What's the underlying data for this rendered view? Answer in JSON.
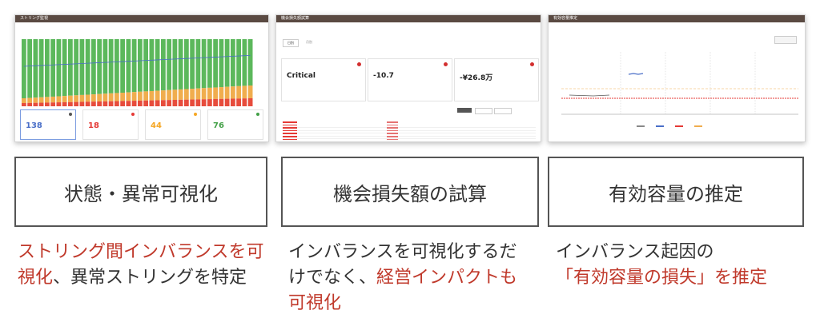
{
  "panels": [
    {
      "screen": {
        "title": "ストリング監視",
        "kpis": [
          {
            "value": "138",
            "color": "#4a6fc8"
          },
          {
            "value": "18",
            "color": "#e53935"
          },
          {
            "value": "44",
            "color": "#f5a623"
          },
          {
            "value": "76",
            "color": "#43a047"
          }
        ]
      },
      "label": "状態・異常可視化",
      "caption_parts": [
        {
          "text": "ストリング間インバランスを可視化",
          "highlight": true
        },
        {
          "text": "、異常ストリングを特定",
          "highlight": false
        }
      ]
    },
    {
      "screen": {
        "title": "機会損失額試算",
        "tabs": [
          "日別",
          "月別"
        ],
        "cards": [
          {
            "value": "Critical"
          },
          {
            "value": "-10.7"
          },
          {
            "value": "-¥26.8万"
          }
        ],
        "table_rows": 7
      },
      "label": "機会損失額の試算",
      "caption_parts": [
        {
          "text": "インバランスを可視化するだけでなく、",
          "highlight": false
        },
        {
          "text": "経営インパクトも可視化",
          "highlight": true
        }
      ]
    },
    {
      "screen": {
        "title": "有効容量推定"
      },
      "label": "有効容量の推定",
      "caption_parts": [
        {
          "text": "インバランス起因の",
          "highlight": false
        },
        {
          "text": "「有効容量の損失」を推定",
          "highlight": true
        }
      ]
    }
  ],
  "chart_data": {
    "type": "bar",
    "stack_colors": {
      "green": "#5cb85c",
      "orange": "#f0ad4e",
      "red": "#e74c3c"
    },
    "bars": 40
  }
}
